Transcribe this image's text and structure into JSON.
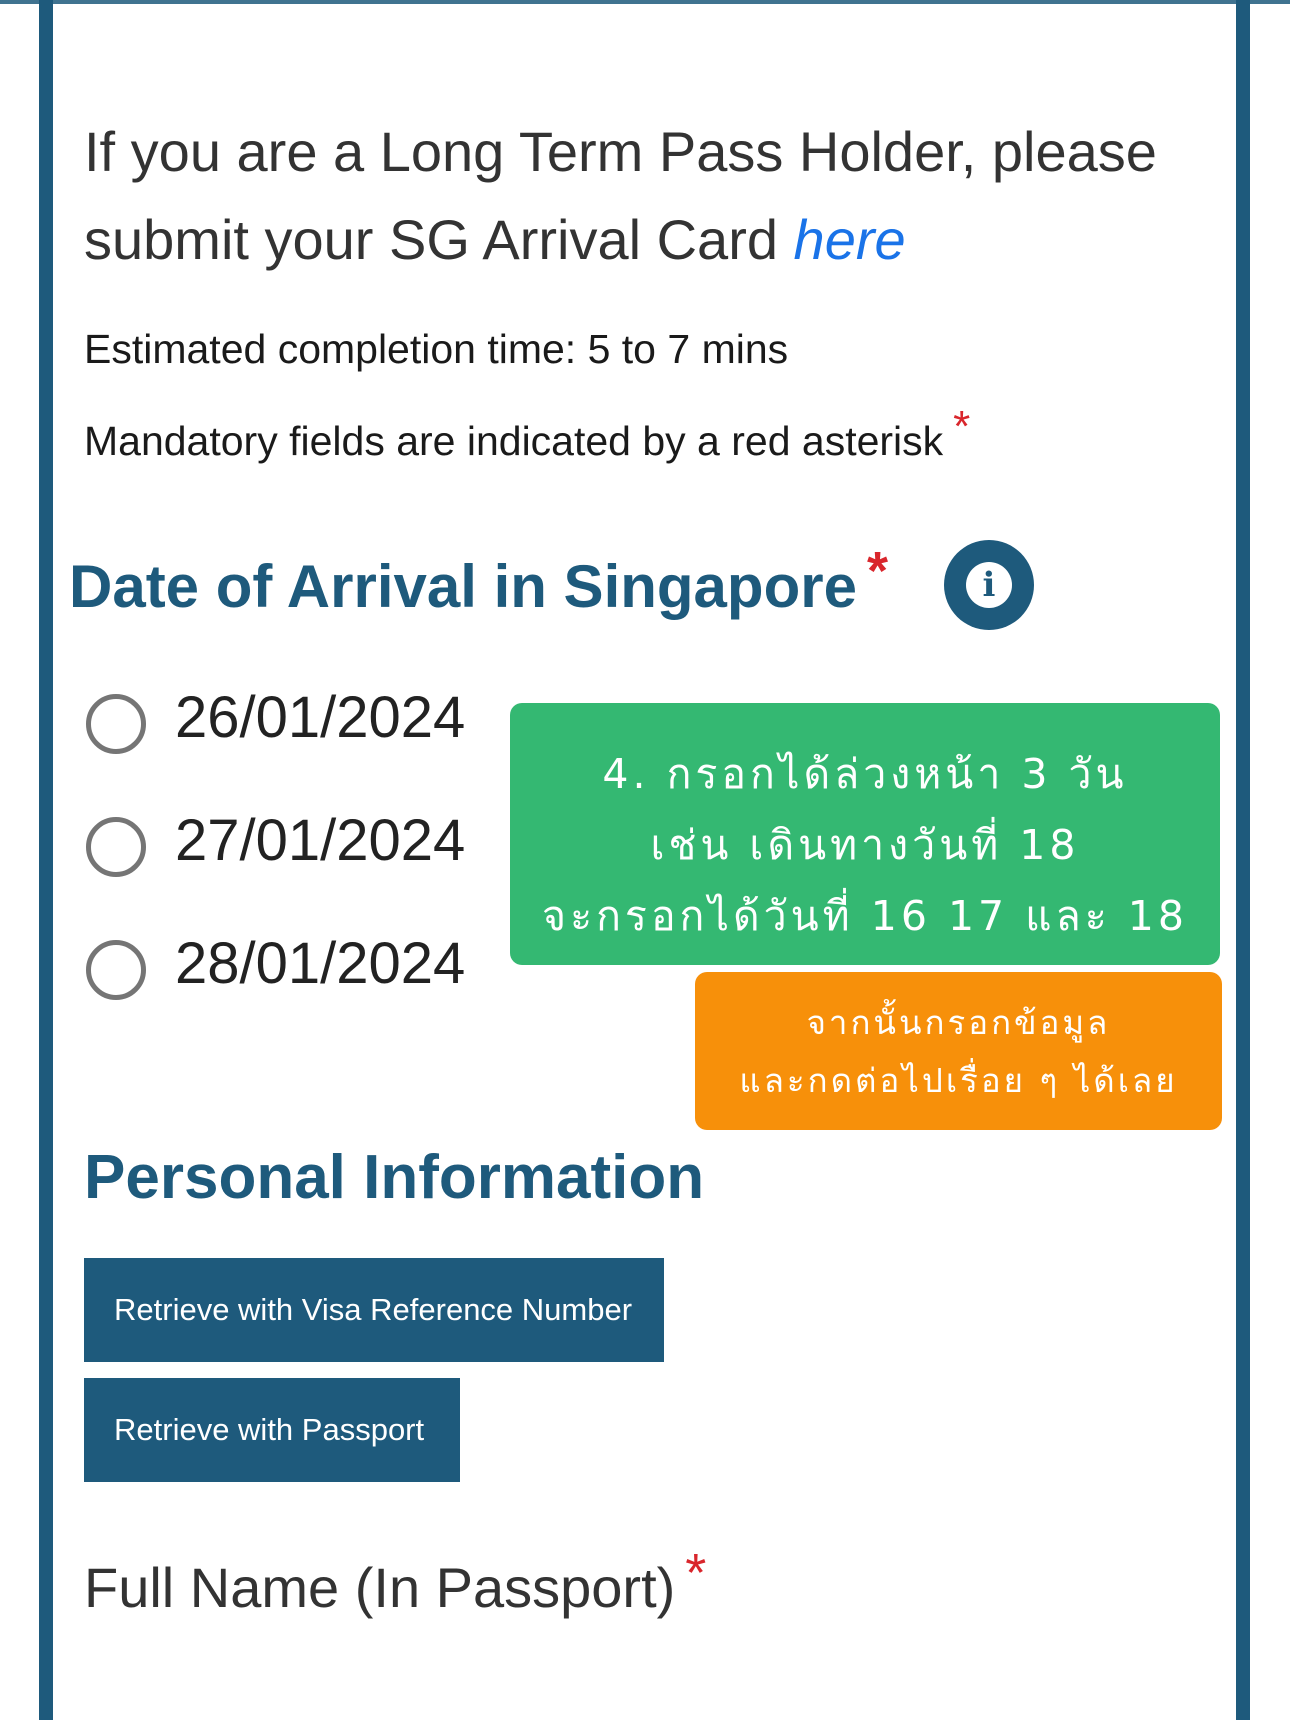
{
  "intro": {
    "text": "If you are a Long Term Pass Holder, please submit your SG Arrival Card ",
    "link_label": "here"
  },
  "info": {
    "completion_time": "Estimated completion time: 5 to 7 mins",
    "mandatory_note": "Mandatory fields are indicated by a red asterisk"
  },
  "required_marker": "*",
  "arrival": {
    "heading": "Date of Arrival in Singapore",
    "info_icon": "i",
    "options": [
      {
        "label": "26/01/2024",
        "selected": false
      },
      {
        "label": "27/01/2024",
        "selected": false
      },
      {
        "label": "28/01/2024",
        "selected": false
      }
    ]
  },
  "notes": {
    "green": {
      "lines": [
        "4. กรอกได้ล่วงหน้า 3 วัน",
        "เช่น เดินทางวันที่ 18",
        "จะกรอกได้วันที่ 16 17 และ 18"
      ]
    },
    "orange": {
      "lines": [
        "จากนั้นกรอกข้อมูล",
        "และกดต่อไปเรื่อย ๆ ได้เลย"
      ]
    }
  },
  "personal": {
    "heading": "Personal Information",
    "retrieve_visa_label": "Retrieve with Visa Reference Number",
    "retrieve_passport_label": "Retrieve with Passport",
    "full_name_label": "Full Name (In Passport)"
  },
  "colors": {
    "brand": "#1e5a7c",
    "link": "#1a73e8",
    "required": "#d9262c",
    "note_green": "#34b872",
    "note_orange": "#f7900a"
  },
  "icons": {
    "info": "info-icon",
    "radio": "radio-unchecked-icon"
  }
}
